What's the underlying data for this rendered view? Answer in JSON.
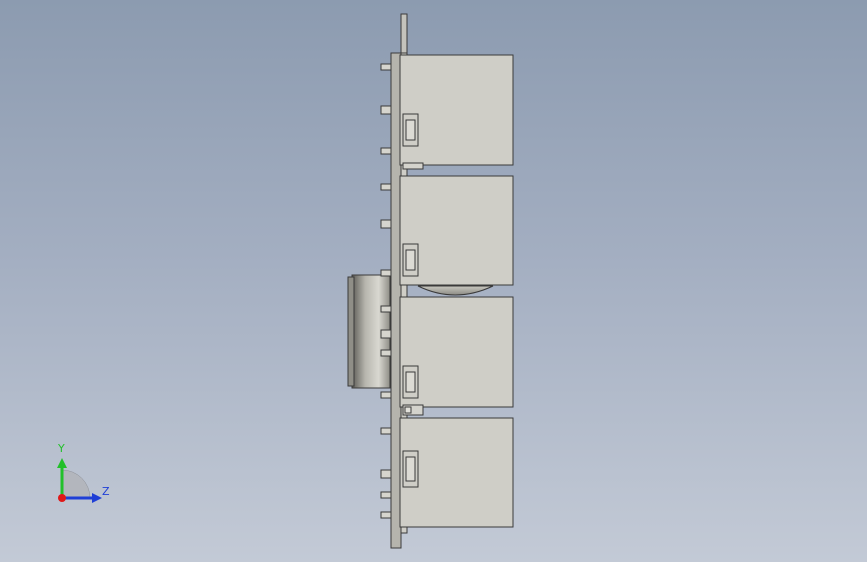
{
  "view": {
    "background_top": "#8c9bb0",
    "background_bottom": "#c3cad6",
    "part_fill": "#cfcec7",
    "plate_fill": "#b5b4ad",
    "edge_color": "#3a3a3a"
  },
  "triad": {
    "y_label": "Y",
    "z_label": "Z",
    "y_color": "#22c02a",
    "z_color": "#1f3fd6",
    "x_color": "#e01818"
  }
}
